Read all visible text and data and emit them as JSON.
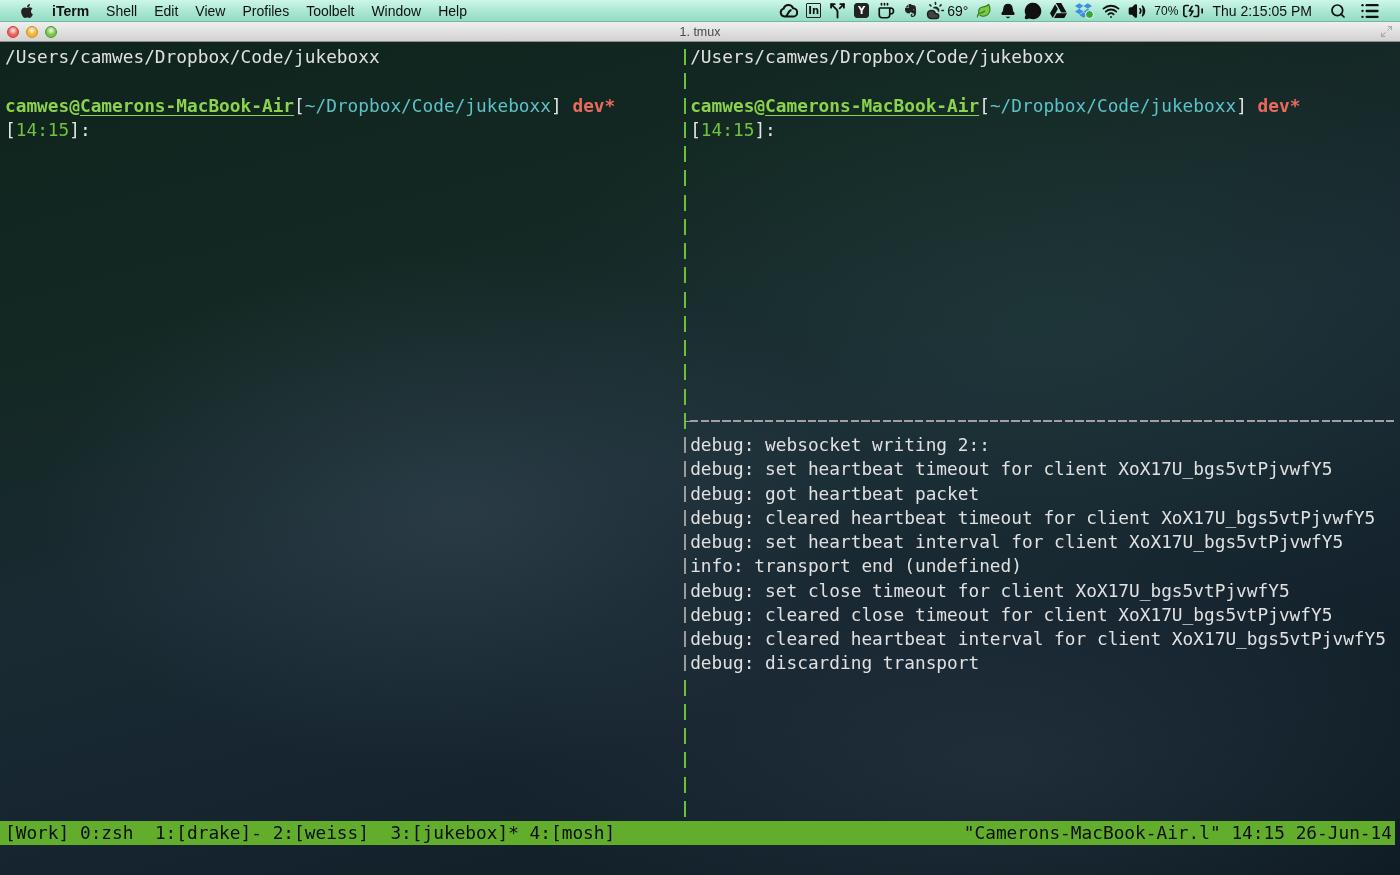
{
  "menu_bar": {
    "app_name": "iTerm",
    "menus": [
      "Shell",
      "Edit",
      "View",
      "Profiles",
      "Toolbelt",
      "Window",
      "Help"
    ],
    "outlined_tile": "In",
    "filled_tile": "Y",
    "temperature": "69°",
    "battery_percent": "70%",
    "clock": "Thu 2:15:05 PM"
  },
  "window": {
    "title": "1. tmux"
  },
  "left_pane": {
    "lines": [
      {
        "kind": "path",
        "text": "/Users/camwes/Dropbox/Code/jukeboxx"
      },
      {
        "kind": "blank"
      },
      {
        "kind": "prompt",
        "segments": [
          {
            "kind": "user",
            "text": "camwes@"
          },
          {
            "kind": "host",
            "text": "Camerons-MacBook-Air"
          },
          {
            "kind": "punct",
            "text": "["
          },
          {
            "kind": "cwd",
            "text": "~/Dropbox/Code/jukeboxx"
          },
          {
            "kind": "punct",
            "text": "]"
          },
          {
            "kind": "branch",
            "text": "dev*"
          }
        ]
      },
      {
        "kind": "prompt",
        "segments": [
          {
            "kind": "punct",
            "text": "["
          },
          {
            "kind": "time",
            "text": "14:15"
          },
          {
            "kind": "punct",
            "text": "]:"
          }
        ]
      }
    ]
  },
  "right_top_pane": {
    "lines": [
      {
        "kind": "path",
        "text": "/Users/camwes/Dropbox/Code/jukeboxx"
      },
      {
        "kind": "blank"
      },
      {
        "kind": "prompt",
        "segments": [
          {
            "kind": "user",
            "text": "camwes@"
          },
          {
            "kind": "host",
            "text": "Camerons-MacBook-Air"
          },
          {
            "kind": "punct",
            "text": "["
          },
          {
            "kind": "cwd",
            "text": "~/Dropbox/Code/jukeboxx"
          },
          {
            "kind": "punct",
            "text": "]"
          },
          {
            "kind": "branch",
            "text": "dev*"
          }
        ]
      },
      {
        "kind": "prompt",
        "segments": [
          {
            "kind": "punct",
            "text": "["
          },
          {
            "kind": "time",
            "text": "14:15"
          },
          {
            "kind": "punct",
            "text": "]:"
          }
        ]
      }
    ]
  },
  "right_bottom_pane": {
    "lines": [
      "debug: websocket writing 2::",
      "debug: set heartbeat timeout for client XoX17U_bgs5vtPjvwfY5",
      "debug: got heartbeat packet",
      "debug: cleared heartbeat timeout for client XoX17U_bgs5vtPjvwfY5",
      "debug: set heartbeat interval for client XoX17U_bgs5vtPjvwfY5",
      "info: transport end (undefined)",
      "debug: set close timeout for client XoX17U_bgs5vtPjvwfY5",
      "debug: cleared close timeout for client XoX17U_bgs5vtPjvwfY5",
      "debug: cleared heartbeat interval for client XoX17U_bgs5vtPjvwfY5",
      "debug: discarding transport"
    ]
  },
  "status_bar": {
    "session": "[Work]",
    "windows": [
      {
        "name": "0:zsh"
      },
      {
        "name": "1:[drake]",
        "flag": "-"
      },
      {
        "name": "2:[weiss]"
      },
      {
        "name": "3:[jukebox]",
        "flag": "*"
      },
      {
        "name": "4:[mosh]"
      }
    ],
    "host": "\"Camerons-MacBook-Air.l\"",
    "time": "14:15",
    "date": "26-Jun-14"
  }
}
